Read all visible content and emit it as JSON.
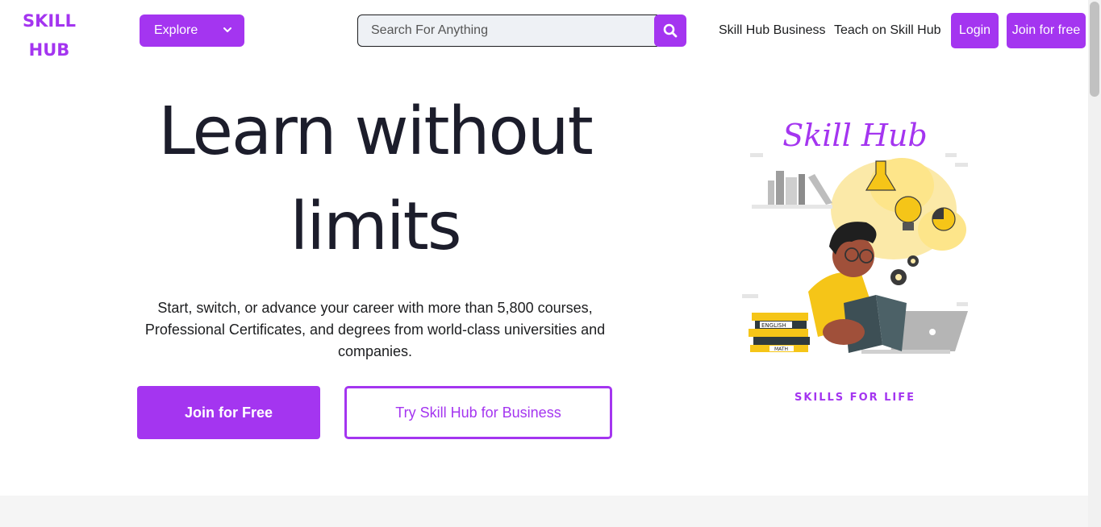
{
  "logo": {
    "line1": "SKILL",
    "line2": "HUB"
  },
  "header": {
    "explore_label": "Explore",
    "search_placeholder": "Search For Anything",
    "search_value": "",
    "nav_business": "Skill Hub Business",
    "nav_teach": "Teach on Skill Hub",
    "login_label": "Login",
    "join_label": "Join for free"
  },
  "hero": {
    "title_line1": "Learn without",
    "title_line2": "limits",
    "subtitle": "Start, switch, or advance your career with more than 5,800 courses, Professional Certificates, and degrees from world-class universities and companies.",
    "primary_button": "Join for Free",
    "secondary_button": "Try Skill Hub for Business"
  },
  "illustration": {
    "title": "Skill Hub",
    "tagline": "SKILLS FOR LIFE",
    "book_labels": [
      "ENGLISH",
      "MATH"
    ]
  },
  "colors": {
    "brand": "#a435f0",
    "text": "#1c1d1f",
    "accent_yellow": "#f5c518"
  }
}
